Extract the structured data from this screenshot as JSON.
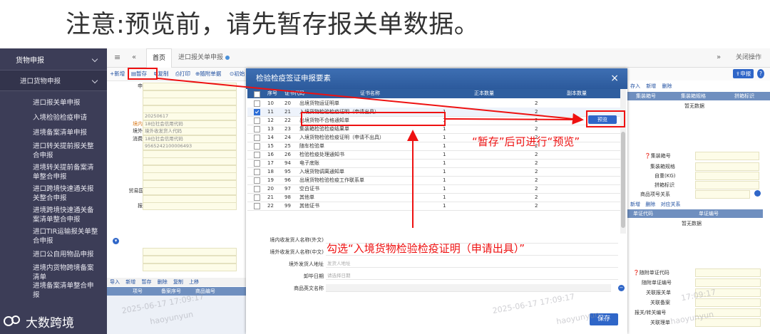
{
  "notice": "注意:预览前，请先暂存报关单数据。",
  "sidebar": {
    "header": "货物申报",
    "submenu": "进口货物申报",
    "items": [
      "进口报关单申报",
      "入境检验检疫申请",
      "进境备案清单申报",
      "进口转关提前报关整合申报",
      "进境转关提前备案清单整合申报",
      "进口跨境快速通关报关整合申报",
      "进境跨境快速通关备案清单整合申报",
      "进口TIR运输报关单整合申报",
      "进口公自用物品申报",
      "进境内货物跨境备案清单",
      "进境备案清单整合申报"
    ]
  },
  "tabs": {
    "home": "首页",
    "current": "进口报关单申报",
    "close_ops": "关闭操作"
  },
  "toolbar": [
    "新增",
    "暂存",
    "复制",
    "打印",
    "随附单据",
    "初始"
  ],
  "toolbar_right": "申报",
  "form_left": [
    {
      "label": "申报地海关",
      "value": ""
    },
    {
      "label": "统一编号",
      "value": ""
    },
    {
      "label": "海关编号",
      "value": ""
    },
    {
      "label": "备案号",
      "value": ""
    },
    {
      "label": "进口日期",
      "value": "20250617"
    },
    {
      "label": "境内收发货人",
      "value": "18位社会信用代码"
    },
    {
      "label": "境外收发货人",
      "value": "境外收发货人代码"
    },
    {
      "label": "消费使用单位",
      "value": "18位社会信用代码"
    },
    {
      "label": "申报单位",
      "value": "9565242100006493"
    },
    {
      "label": "运输方式",
      "value": ""
    },
    {
      "label": "运输单号",
      "value": ""
    },
    {
      "label": "许可证号",
      "value": ""
    },
    {
      "label": "运费",
      "value": ""
    },
    {
      "label": "包装种类",
      "value": ""
    },
    {
      "label": "贸易国别(地区)",
      "value": ""
    },
    {
      "label": "入境口岸",
      "value": ""
    },
    {
      "label": "报关单类型",
      "value": ""
    }
  ],
  "form_left_lower": [
    {
      "label": "启运港",
      "value": ""
    },
    {
      "label": "B/L号",
      "value": ""
    },
    {
      "label": "原箱运输",
      "value": ""
    }
  ],
  "goods_toolbar": [
    "导入",
    "新增",
    "暂存",
    "删除",
    "复制",
    "上移"
  ],
  "goods_headers": [
    "项号",
    "备案序号",
    "商品编号"
  ],
  "right_panel": {
    "top_buttons": [
      "存入",
      "新增",
      "删除"
    ],
    "headers": [
      "集装箱号",
      "集装箱规格",
      "拼箱标识"
    ],
    "empty": "暂无数据",
    "fields": [
      "集装箱号",
      "集装箱规格",
      "自重(KG)",
      "拼箱标识",
      "商品项号关系"
    ],
    "mid_buttons": [
      "新增",
      "删除",
      "对应关系"
    ],
    "mid_headers": [
      "单证代码",
      "单证编号"
    ],
    "empty2": "暂无数据",
    "lower_fields": [
      "随附单证代码",
      "随附单证编号",
      "关联报关单",
      "关联备案",
      "报关/转关编号",
      "关联理单"
    ]
  },
  "modal": {
    "title": "检验检疫签证申报要素",
    "headers": [
      "序号",
      "证书代码",
      "证书名称",
      "正本数量",
      "副本数量"
    ],
    "rows": [
      {
        "no": "10",
        "code": "20",
        "name": "出境货物运证明单",
        "orig": "",
        "copy": "2",
        "checked": false
      },
      {
        "no": "11",
        "code": "21",
        "name": "入境货物检验检疫证明（申请出具）",
        "orig": "1",
        "copy": "2",
        "checked": true
      },
      {
        "no": "12",
        "code": "22",
        "name": "出境货物不合格通知单",
        "orig": "1",
        "copy": "2",
        "checked": false
      },
      {
        "no": "13",
        "code": "23",
        "name": "集装箱检验检疫结果单",
        "orig": "1",
        "copy": "2",
        "checked": false
      },
      {
        "no": "14",
        "code": "24",
        "name": "入境货物检验检疫证明（申请不出具）",
        "orig": "1",
        "copy": "2",
        "checked": false
      },
      {
        "no": "15",
        "code": "25",
        "name": "随车检验单",
        "orig": "1",
        "copy": "2",
        "checked": false
      },
      {
        "no": "16",
        "code": "26",
        "name": "检验检疫处理通知书",
        "orig": "1",
        "copy": "2",
        "checked": false
      },
      {
        "no": "17",
        "code": "94",
        "name": "电子底账",
        "orig": "1",
        "copy": "2",
        "checked": false
      },
      {
        "no": "18",
        "code": "95",
        "name": "入境货物调离通知单",
        "orig": "1",
        "copy": "2",
        "checked": false
      },
      {
        "no": "19",
        "code": "96",
        "name": "出境货物检验检疫工作联系单",
        "orig": "1",
        "copy": "2",
        "checked": false
      },
      {
        "no": "20",
        "code": "97",
        "name": "空白证书",
        "orig": "1",
        "copy": "2",
        "checked": false
      },
      {
        "no": "21",
        "code": "98",
        "name": "其他单",
        "orig": "1",
        "copy": "2",
        "checked": false
      },
      {
        "no": "22",
        "code": "99",
        "name": "其他证书",
        "orig": "1",
        "copy": "2",
        "checked": false
      }
    ],
    "form": [
      {
        "label": "境内收发货人名称(外文)",
        "placeholder": ""
      },
      {
        "label": "境外收发货人名称(中文)",
        "placeholder": ""
      },
      {
        "label": "境外发货人地址",
        "placeholder": "发货人地址"
      },
      {
        "label": "卸毕日期",
        "placeholder": "请选择日期"
      },
      {
        "label": "商品英文名称",
        "placeholder": ""
      }
    ],
    "preview_button": "预览",
    "save_button": "保存"
  },
  "annotations": {
    "after_save": "“暂存”后可进行“预览”",
    "check_hint": "勾选“入境货物检验检疫证明（申请出具）”"
  },
  "watermarks": [
    "2025-06-17 17:09:17",
    "haoyunyun",
    "2025-06-17 17:09:17",
    "haoyunyun",
    "17:09:17",
    "haoyunyun"
  ],
  "logo_text": "大数跨境",
  "colors": {
    "sidebar": "#3c3d57",
    "modal_header": "#2c5a9c",
    "annotation": "#e11111",
    "accent": "#2f66c8"
  }
}
